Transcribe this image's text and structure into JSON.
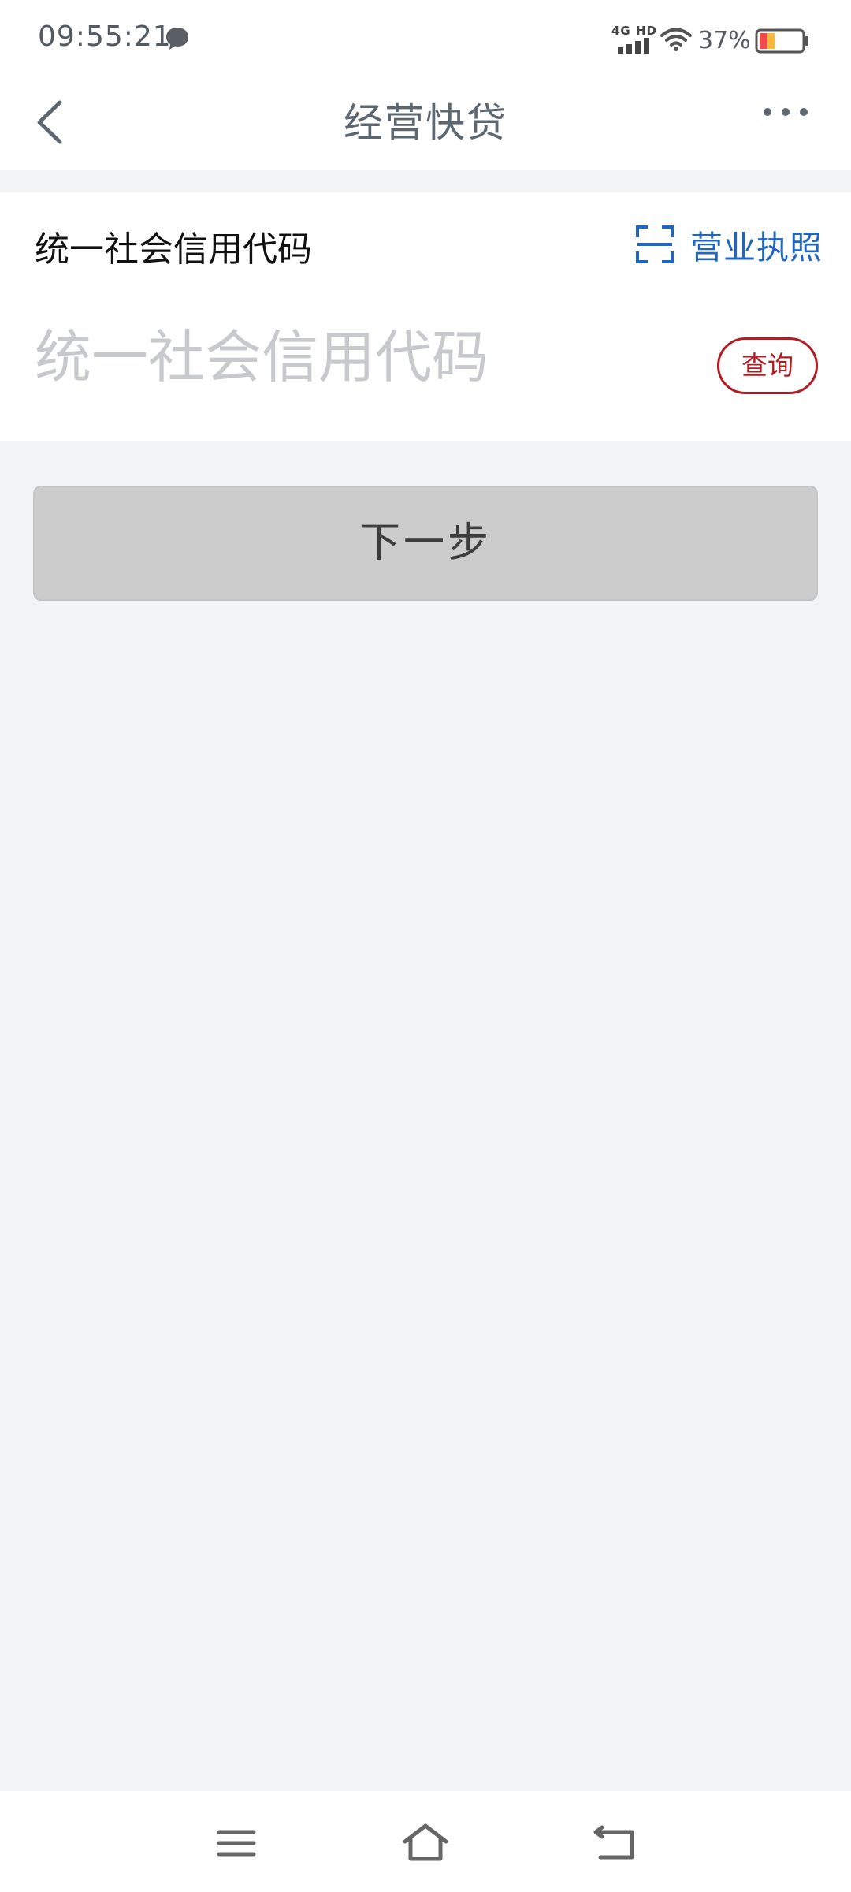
{
  "status_bar": {
    "time": "09:55:21",
    "network": "4G HD",
    "battery_percent": "37%",
    "battery_level": 0.37,
    "icons": [
      "chat-bubble-icon",
      "signal-icon",
      "wifi-icon",
      "battery-icon"
    ]
  },
  "nav": {
    "title": "经营快贷",
    "back_icon": "chevron-left-icon",
    "more_icon": "more-dots-icon"
  },
  "form": {
    "field_label": "统一社会信用代码",
    "license_button": "营业执照",
    "scan_icon": "scan-frame-icon",
    "code_input": {
      "value": "",
      "placeholder": "统一社会信用代码"
    },
    "query_button": "查询"
  },
  "next_button": "下一步",
  "system_nav": [
    "menu-icon",
    "home-icon",
    "back-icon"
  ],
  "colors": {
    "accent_blue": "#2065c1",
    "accent_red": "#b21d24",
    "background": "#f3f4f6",
    "disabled_button": "#cccccc"
  }
}
